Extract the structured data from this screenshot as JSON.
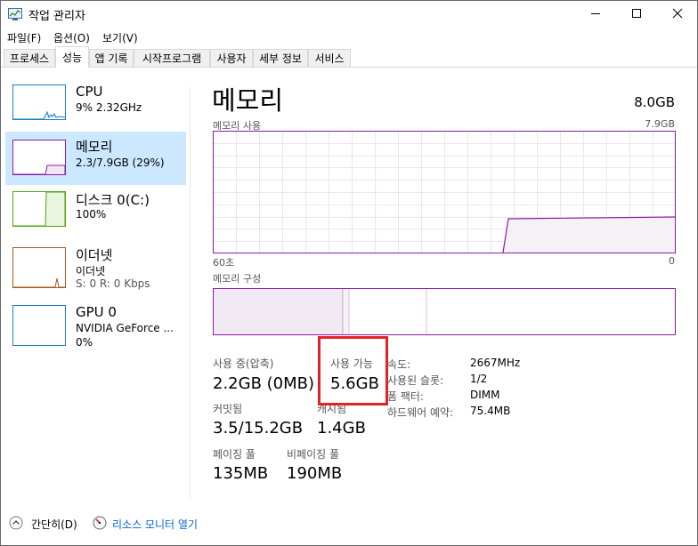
{
  "window": {
    "title": "작업 관리자"
  },
  "menu": [
    "파일(F)",
    "옵션(O)",
    "보기(V)"
  ],
  "tabs": [
    {
      "label": "프로세스"
    },
    {
      "label": "성능",
      "active": true
    },
    {
      "label": "앱 기록"
    },
    {
      "label": "시작프로그램"
    },
    {
      "label": "사용자"
    },
    {
      "label": "세부 정보"
    },
    {
      "label": "서비스"
    }
  ],
  "sidebar": {
    "items": [
      {
        "title": "CPU",
        "sub1": "9% 2.32GHz",
        "sub2": "",
        "accent": "#1a7fc1"
      },
      {
        "title": "메모리",
        "sub1": "2.3/7.9GB (29%)",
        "sub2": "",
        "accent": "#8c1aa8",
        "selected": true
      },
      {
        "title": "디스크 0(C:)",
        "sub1": "100%",
        "sub2": "",
        "accent": "#4da60c"
      },
      {
        "title": "이더넷",
        "sub1": "이더넷",
        "sub2": "S: 0 R: 0 Kbps",
        "accent": "#a7591d"
      },
      {
        "title": "GPU 0",
        "sub1": "NVIDIA GeForce ...",
        "sub2": "0%",
        "accent": "#1a7fc1"
      }
    ]
  },
  "main": {
    "title": "메모리",
    "total": "8.0GB",
    "usage_label": "메모리 사용",
    "usage_max": "7.9GB",
    "time_left": "60초",
    "time_right": "0",
    "composition_label": "메모리 구성",
    "usage_percent": 29,
    "stats": {
      "in_use_label": "사용 중(압축)",
      "in_use_value": "2.2GB (0MB)",
      "available_label": "사용 가능",
      "available_value": "5.6GB",
      "committed_label": "커밋됨",
      "committed_value": "3.5/15.2GB",
      "cached_label": "캐시됨",
      "cached_value": "1.4GB",
      "paged_label": "페이징 풀",
      "paged_value": "135MB",
      "nonpaged_label": "비페이징 풀",
      "nonpaged_value": "190MB"
    },
    "specs": [
      {
        "label": "속도:",
        "value": "2667MHz"
      },
      {
        "label": "사용된 슬롯:",
        "value": "1/2"
      },
      {
        "label": "폼 팩터:",
        "value": "DIMM"
      },
      {
        "label": "하드웨어 예약:",
        "value": "75.4MB"
      }
    ]
  },
  "footer": {
    "fewer_details": "간단히(D)",
    "resource_monitor": "리소스 모니터 열기"
  },
  "colors": {
    "memory_accent": "#8c1aa8",
    "graph_fill": "#f4f2f4",
    "graph_grid": "#efe3f2",
    "highlight": "#e22227"
  }
}
